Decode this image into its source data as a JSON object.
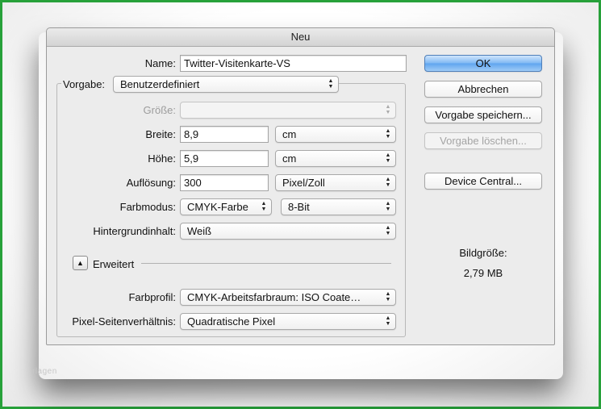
{
  "dialog": {
    "title": "Neu",
    "name_label": "Name:",
    "name_value": "Twitter-Visitenkarte-VS",
    "preset_label": "Vorgabe:",
    "preset_value": "Benutzerdefiniert",
    "size_label": "Größe:",
    "size_value": "",
    "width_label": "Breite:",
    "width_value": "8,9",
    "width_unit": "cm",
    "height_label": "Höhe:",
    "height_value": "5,9",
    "height_unit": "cm",
    "resolution_label": "Auflösung:",
    "resolution_value": "300",
    "resolution_unit": "Pixel/Zoll",
    "color_mode_label": "Farbmodus:",
    "color_mode_value": "CMYK-Farbe",
    "bit_depth_value": "8-Bit",
    "background_label": "Hintergrundinhalt:",
    "background_value": "Weiß",
    "advanced_label": "Erweitert",
    "color_profile_label": "Farbprofil:",
    "color_profile_value": "CMYK-Arbeitsfarbraum:  ISO Coate…",
    "pixel_aspect_label": "Pixel-Seitenverhältnis:",
    "pixel_aspect_value": "Quadratische Pixel"
  },
  "buttons": {
    "ok": "OK",
    "cancel": "Abbrechen",
    "save_preset": "Vorgabe speichern...",
    "delete_preset": "Vorgabe löschen...",
    "device_central": "Device Central..."
  },
  "image_size": {
    "label": "Bildgröße:",
    "value": "2,79 MB"
  },
  "watermark": "rlagen",
  "colors": {
    "frame_border": "#27a13a",
    "ok_button": "#7fb8f3"
  }
}
